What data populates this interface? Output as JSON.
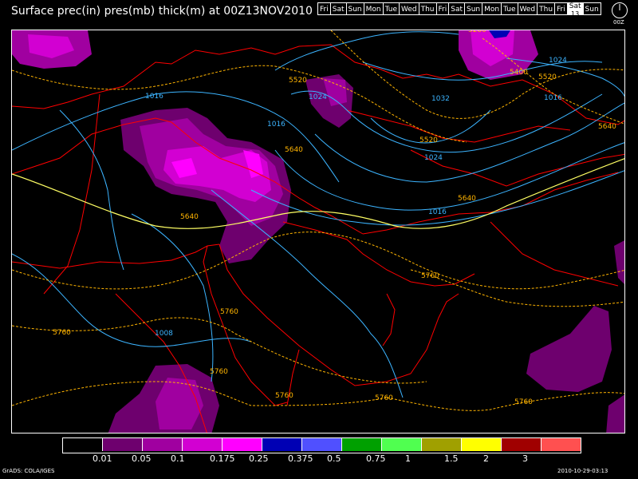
{
  "title": "Surface prec(in) pres(mb) thick(m) at 00Z13NOV2010",
  "time_bar": {
    "days": [
      "Fri",
      "Sat",
      "Sun",
      "Mon",
      "Tue",
      "Wed",
      "Thu",
      "Fri",
      "Sat",
      "Sun",
      "Mon",
      "Tue",
      "Wed",
      "Thu",
      "Fri",
      "Sat",
      "Sun"
    ],
    "selected_index": 15,
    "selected_sub": "13",
    "clock_label": "00Z"
  },
  "legend": {
    "labels": [
      "0.01",
      "0.05",
      "0.1",
      "0.175",
      "0.25",
      "0.375",
      "0.5",
      "0.75",
      "1",
      "1.5",
      "2",
      "3"
    ],
    "colors": [
      "#000000",
      "#6e006e",
      "#a000a0",
      "#d200d2",
      "#ff00ff",
      "#0000b4",
      "#5050ff",
      "#00a000",
      "#50ff50",
      "#a0a000",
      "#ffff00",
      "#a00000",
      "#ff5050"
    ]
  },
  "contour_labels": {
    "pressure": [
      "1016",
      "1024",
      "1016",
      "1032",
      "1024",
      "1024",
      "1016",
      "1016",
      "1008"
    ],
    "thickness": [
      "5520",
      "5280",
      "5400",
      "5520",
      "5640",
      "5640",
      "5520",
      "5640",
      "5640",
      "5760",
      "5760",
      "5760",
      "5760",
      "5760",
      "5760",
      "5760"
    ]
  },
  "colors": {
    "pressure": "#3cb4ff",
    "thickness": "#ffb400",
    "thickness_mid": "#ffff64",
    "borders": "#ff0000"
  },
  "credit": "GrADS: COLA/IGES",
  "timestamp": "2010-10-29-03:13"
}
